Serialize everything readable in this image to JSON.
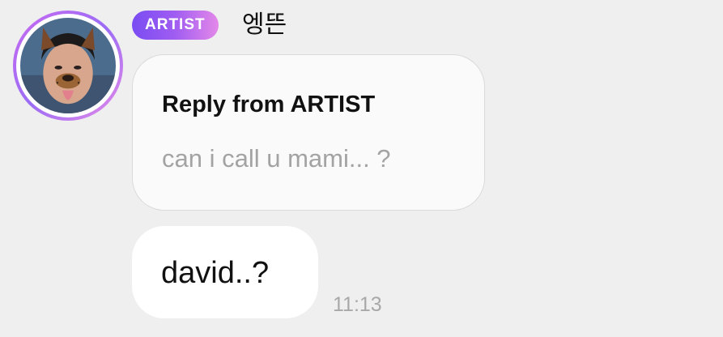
{
  "sender": {
    "badge": "ARTIST",
    "name": "엥뜬",
    "avatar_icon": "profile-photo-dog-filter"
  },
  "reply": {
    "title": "Reply from ARTIST",
    "quoted_text": "can i call u mami... ?"
  },
  "message": {
    "text": "david..?",
    "time": "11:13"
  },
  "colors": {
    "background": "#efefef",
    "badge_gradient_start": "#7a4cf3",
    "badge_gradient_end": "#e488e9",
    "bubble": "#ffffff",
    "quoted_text": "#a3a3a3",
    "timestamp": "#a8a8a8"
  }
}
